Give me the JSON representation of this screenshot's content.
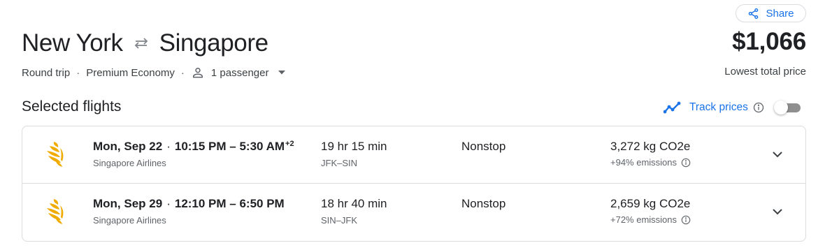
{
  "share": {
    "label": "Share"
  },
  "trip": {
    "origin": "New York",
    "destination": "Singapore",
    "type": "Round trip",
    "cabin": "Premium Economy",
    "passengers": "1 passenger"
  },
  "price": {
    "total": "$1,066",
    "label": "Lowest total price"
  },
  "section": {
    "title": "Selected flights"
  },
  "track": {
    "label": "Track prices",
    "enabled": false
  },
  "flights": [
    {
      "date": "Mon, Sep 22",
      "times": "10:15 PM – 5:30 AM",
      "day_offset": "+2",
      "airline": "Singapore Airlines",
      "duration": "19 hr 15 min",
      "route": "JFK–SIN",
      "stops": "Nonstop",
      "emissions": "3,272 kg CO2e",
      "emissions_delta": "+94% emissions"
    },
    {
      "date": "Mon, Sep 29",
      "times": "12:10 PM – 6:50 PM",
      "day_offset": "",
      "airline": "Singapore Airlines",
      "duration": "18 hr 40 min",
      "route": "SIN–JFK",
      "stops": "Nonstop",
      "emissions": "2,659 kg CO2e",
      "emissions_delta": "+72% emissions"
    }
  ],
  "icons": {
    "share": "share-icon",
    "swap": "swap-arrows-icon",
    "passenger": "person-icon",
    "dropdown": "caret-down-icon",
    "track": "trending-line-icon",
    "info": "info-icon",
    "airline_logo": "singapore-airlines-logo",
    "expand": "chevron-down-icon"
  },
  "colors": {
    "accent": "#1a73e8",
    "logo": "#f0ab00",
    "text": "#202124",
    "muted": "#5f6368",
    "border": "#dadce0"
  }
}
